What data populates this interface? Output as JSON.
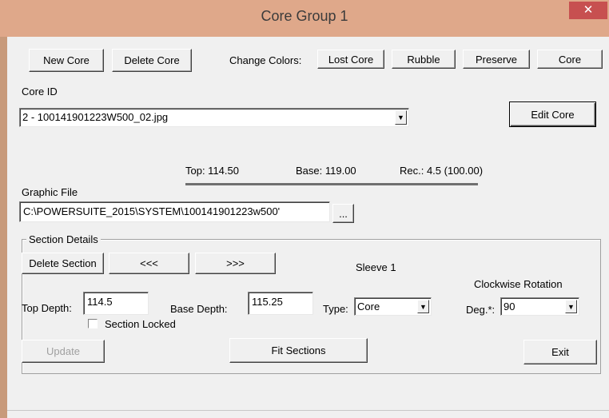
{
  "window": {
    "title": "Core Group 1",
    "close_glyph": "✕"
  },
  "toolbar": {
    "new_core": "New Core",
    "delete_core": "Delete Core",
    "change_colors_label": "Change Colors:",
    "lost_core": "Lost Core",
    "rubble": "Rubble",
    "preserve": "Preserve",
    "core": "Core"
  },
  "core_id": {
    "label": "Core ID",
    "value": "2 - 100141901223W500_02.jpg",
    "edit_button": "Edit Core"
  },
  "core_info": {
    "top": "Top: 114.50",
    "base": "Base: 119.00",
    "rec": "Rec.: 4.5 (100.00)"
  },
  "graphic_file": {
    "label": "Graphic File",
    "value": "C:\\POWERSUITE_2015\\SYSTEM\\100141901223w500'",
    "browse_button": "..."
  },
  "section_details": {
    "title": "Section Details",
    "delete_section": "Delete Section",
    "prev_button": "<<<",
    "next_button": ">>>",
    "sleeve_label": "Sleeve 1",
    "clockwise_label": "Clockwise Rotation",
    "top_depth_label": "Top Depth:",
    "top_depth_value": "114.5",
    "base_depth_label": "Base Depth:",
    "base_depth_value": "115.25",
    "type_label": "Type:",
    "type_value": "Core",
    "deg_label": "Deg.*:",
    "deg_value": "90",
    "section_locked_label": "Section Locked",
    "section_locked_checked": false,
    "update_button": "Update",
    "fit_sections_button": "Fit Sections",
    "exit_button": "Exit"
  },
  "colors": {
    "title_bar": "#dfa88a",
    "close_button": "#c75050",
    "dialog_bg": "#f0f0f0"
  }
}
